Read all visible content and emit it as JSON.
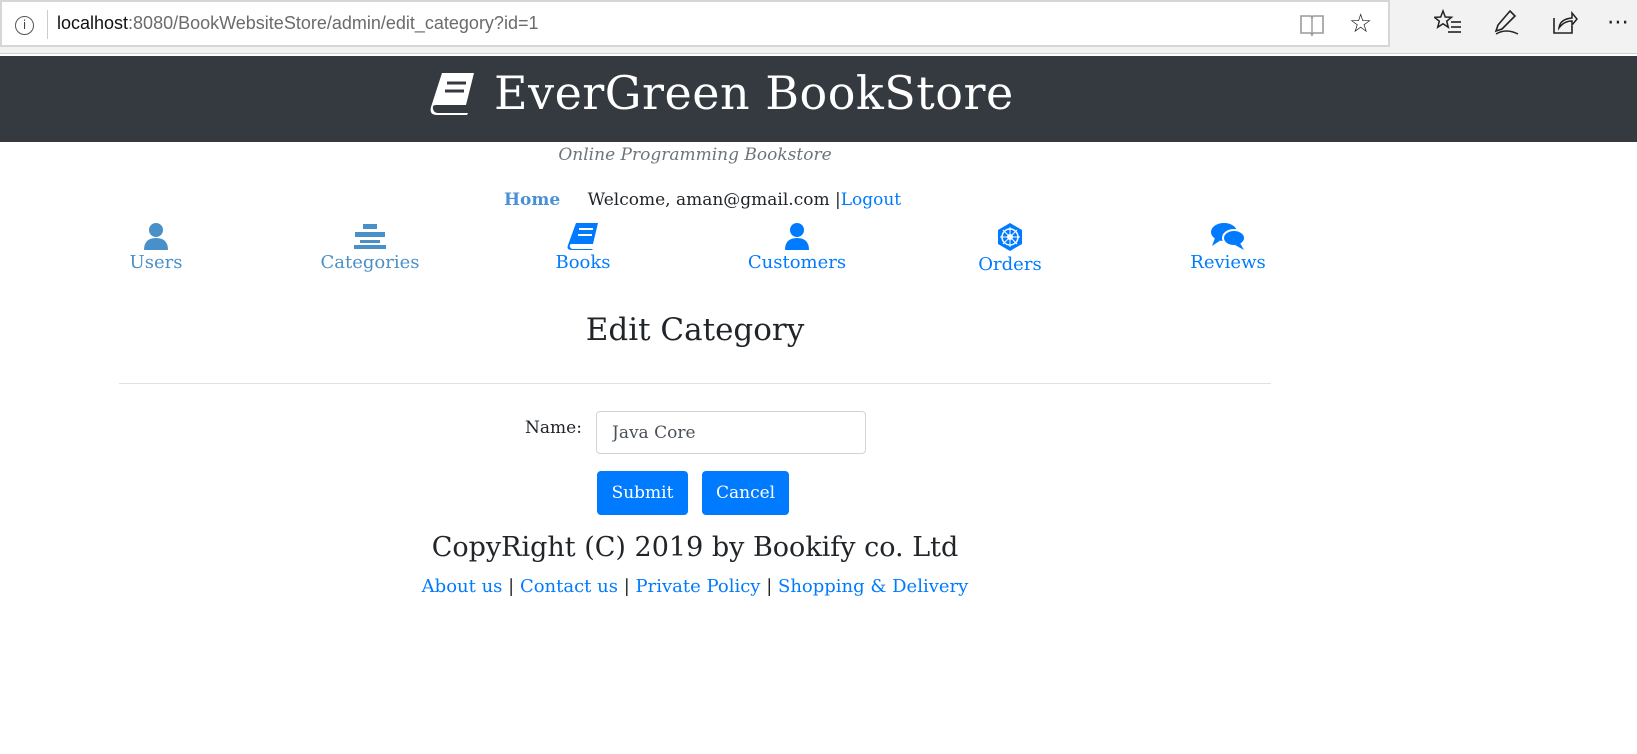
{
  "browser": {
    "url_host": "localhost",
    "url_path": ":8080/BookWebsiteStore/admin/edit_category?id=1",
    "info_glyph": "i"
  },
  "header": {
    "title": "EverGreen BookStore",
    "tagline": "Online Programming Bookstore"
  },
  "topnav": {
    "home": "Home",
    "welcome": "Welcome, aman@gmail.com |",
    "logout": "Logout"
  },
  "menu": {
    "items": [
      {
        "label": "Users",
        "icon": "user-icon"
      },
      {
        "label": "Categories",
        "icon": "categories-icon"
      },
      {
        "label": "Books",
        "icon": "book-icon"
      },
      {
        "label": "Customers",
        "icon": "customer-icon"
      },
      {
        "label": "Orders",
        "icon": "orders-icon"
      },
      {
        "label": "Reviews",
        "icon": "reviews-icon"
      }
    ]
  },
  "form": {
    "title": "Edit Category",
    "name_label": "Name:",
    "name_value": "Java Core",
    "submit_label": "Submit",
    "cancel_label": "Cancel"
  },
  "footer": {
    "copyright": "CopyRight (C) 2019 by Bookify co. Ltd",
    "links": [
      "About us",
      "Contact us",
      "Private Policy",
      "Shopping & Delivery"
    ],
    "separator": " | "
  },
  "colors": {
    "header_bg": "#343a40",
    "primary": "#007bff",
    "muted_link": "#4a90c8"
  }
}
